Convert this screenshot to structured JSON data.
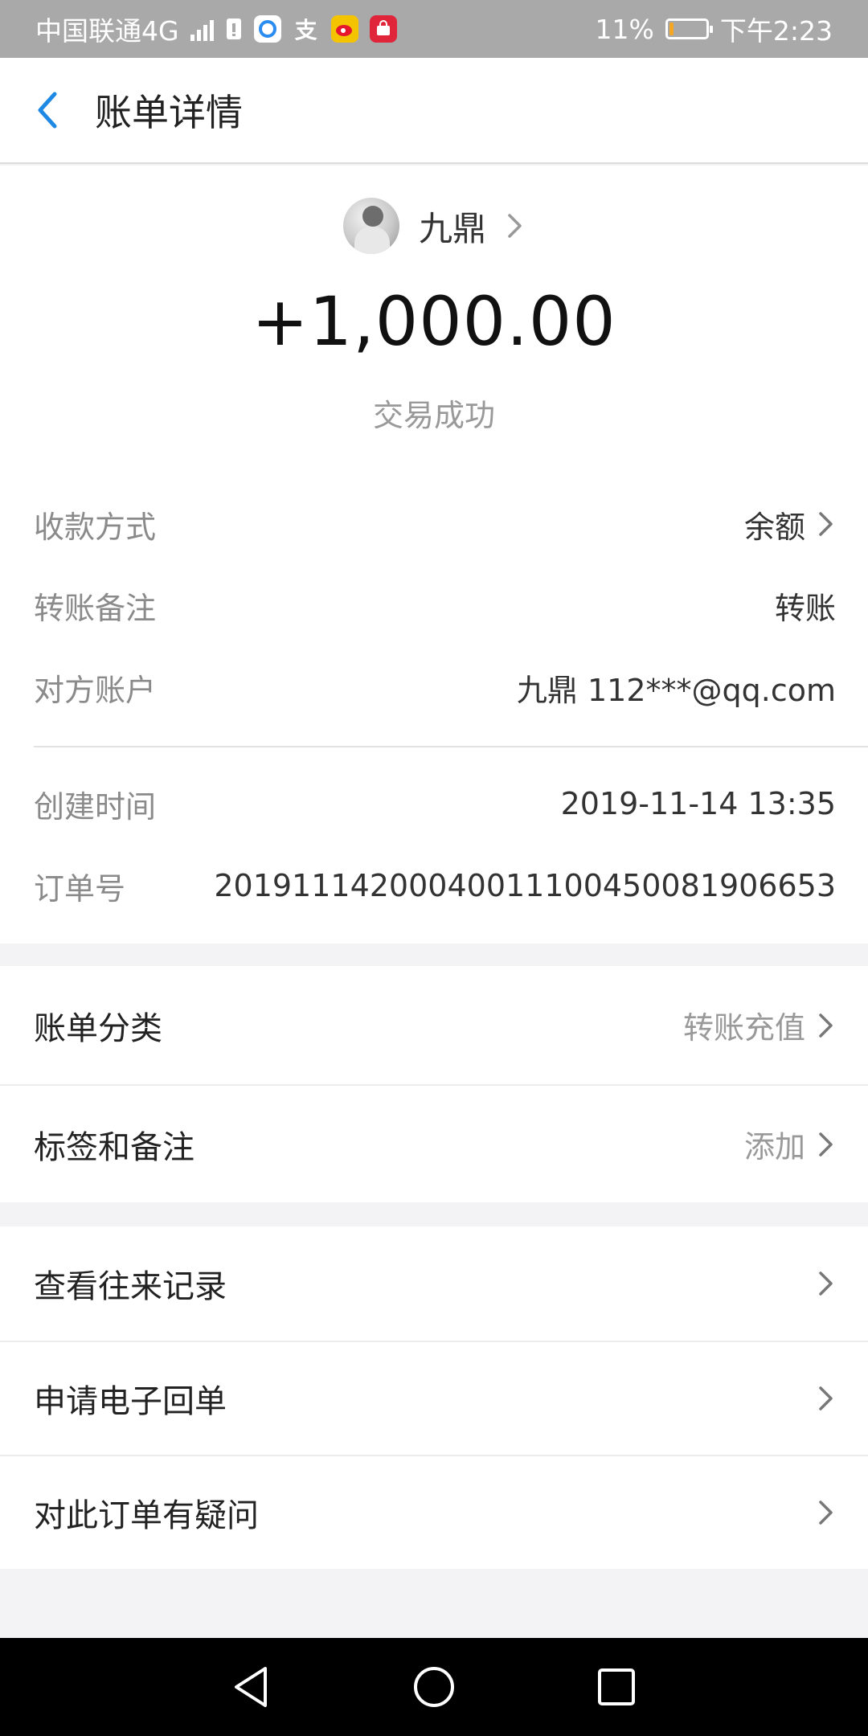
{
  "status_bar": {
    "carrier": "中国联通4G",
    "battery_percent": "11%",
    "battery_level": 0.11,
    "time": "下午2:23",
    "notification_icons": [
      "sim-alert-icon",
      "browser-icon",
      "alipay-icon",
      "weibo-icon",
      "shopping-icon"
    ]
  },
  "header": {
    "title": "账单详情"
  },
  "summary": {
    "payer_name": "九鼎",
    "amount": "+1,000.00",
    "status": "交易成功"
  },
  "details": [
    {
      "label": "收款方式",
      "value": "余额",
      "chevron": true
    },
    {
      "label": "转账备注",
      "value": "转账",
      "chevron": false
    },
    {
      "label": "对方账户",
      "value": "九鼎 112***@qq.com",
      "chevron": false
    },
    {
      "label": "创建时间",
      "value": "2019-11-14 13:35",
      "chevron": false
    },
    {
      "label": "订单号",
      "value": "20191114200040011100450081906653",
      "chevron": false
    }
  ],
  "group1": [
    {
      "label": "账单分类",
      "value": "转账充值"
    },
    {
      "label": "标签和备注",
      "value": "添加"
    }
  ],
  "group2": [
    {
      "label": "查看往来记录"
    },
    {
      "label": "申请电子回单"
    },
    {
      "label": "对此订单有疑问"
    }
  ],
  "colors": {
    "accent": "#1e88e5",
    "status_bar": "#a9a9a9",
    "battery_low": "#f5a623"
  }
}
